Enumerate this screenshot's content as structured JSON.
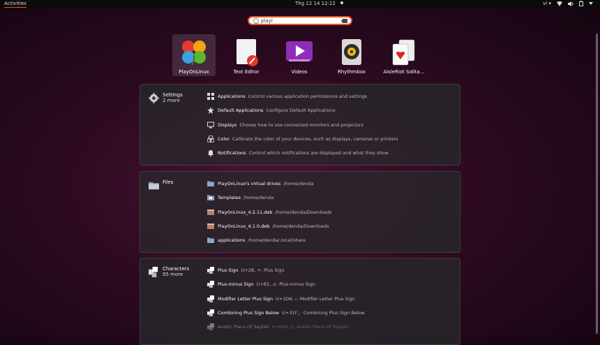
{
  "topbar": {
    "activities": "Activities",
    "clock": "Thg 12 14  12:12",
    "lang": "vi",
    "lang_arrow": "▾"
  },
  "search": {
    "value": "playl"
  },
  "apps": [
    {
      "label": "PlayOnLinux",
      "icon": "playonlinux-icon"
    },
    {
      "label": "Text Editor",
      "icon": "text-editor-icon"
    },
    {
      "label": "Videos",
      "icon": "videos-icon"
    },
    {
      "label": "Rhythmbox",
      "icon": "rhythmbox-icon"
    },
    {
      "label": "AisleRiot Solita…",
      "icon": "aisleriot-icon"
    }
  ],
  "settings": {
    "name": "Settings",
    "more": "2 more",
    "rows": [
      {
        "title": "Applications",
        "desc": "Control various application permissions and settings",
        "icon": "applications-grid-icon"
      },
      {
        "title": "Default Applications",
        "desc": "Configure Default Applications",
        "icon": "star-icon"
      },
      {
        "title": "Displays",
        "desc": "Choose how to use connected monitors and projectors",
        "icon": "display-icon"
      },
      {
        "title": "Color",
        "desc": "Calibrate the color of your devices, such as displays, cameras or printers",
        "icon": "color-icon"
      },
      {
        "title": "Notifications",
        "desc": "Control which notifications are displayed and what they show",
        "icon": "notifications-icon"
      }
    ]
  },
  "files": {
    "name": "Files",
    "rows": [
      {
        "title": "PlayOnLinux's virtual drives",
        "desc": "/home/denda",
        "icon": "folder-icon"
      },
      {
        "title": "Templates",
        "desc": "/home/denda",
        "icon": "folder-icon"
      },
      {
        "title": "PlayOnLinux_4.2.11.deb",
        "desc": "/home/denda/Downloads",
        "icon": "deb-package-icon"
      },
      {
        "title": "PlayOnLinux_4.1.0.deb",
        "desc": "/home/denda/Downloads",
        "icon": "deb-package-icon"
      },
      {
        "title": "applications",
        "desc": "/home/denda/.local/share",
        "icon": "folder-icon"
      }
    ]
  },
  "characters": {
    "name": "Characters",
    "more": "95 more",
    "rows": [
      {
        "title": "Plus Sign",
        "desc": "U+2B, +: Plus Sign",
        "icon": "character-icon"
      },
      {
        "title": "Plus-minus Sign",
        "desc": "U+B1, ±: Plus-minus Sign",
        "icon": "character-icon"
      },
      {
        "title": "Modifier Letter Plus Sign",
        "desc": "U+2D6, ˖: Modifier Letter Plus Sign",
        "icon": "character-icon"
      },
      {
        "title": "Combining Plus Sign Below",
        "desc": "U+31F, ̟: Combining Plus Sign Below",
        "icon": "character-icon"
      },
      {
        "title": "Arabic Place Of Sajdah",
        "desc": "U+6E9, ۩: Arabic Place Of Sajdah",
        "icon": "character-icon"
      }
    ]
  }
}
